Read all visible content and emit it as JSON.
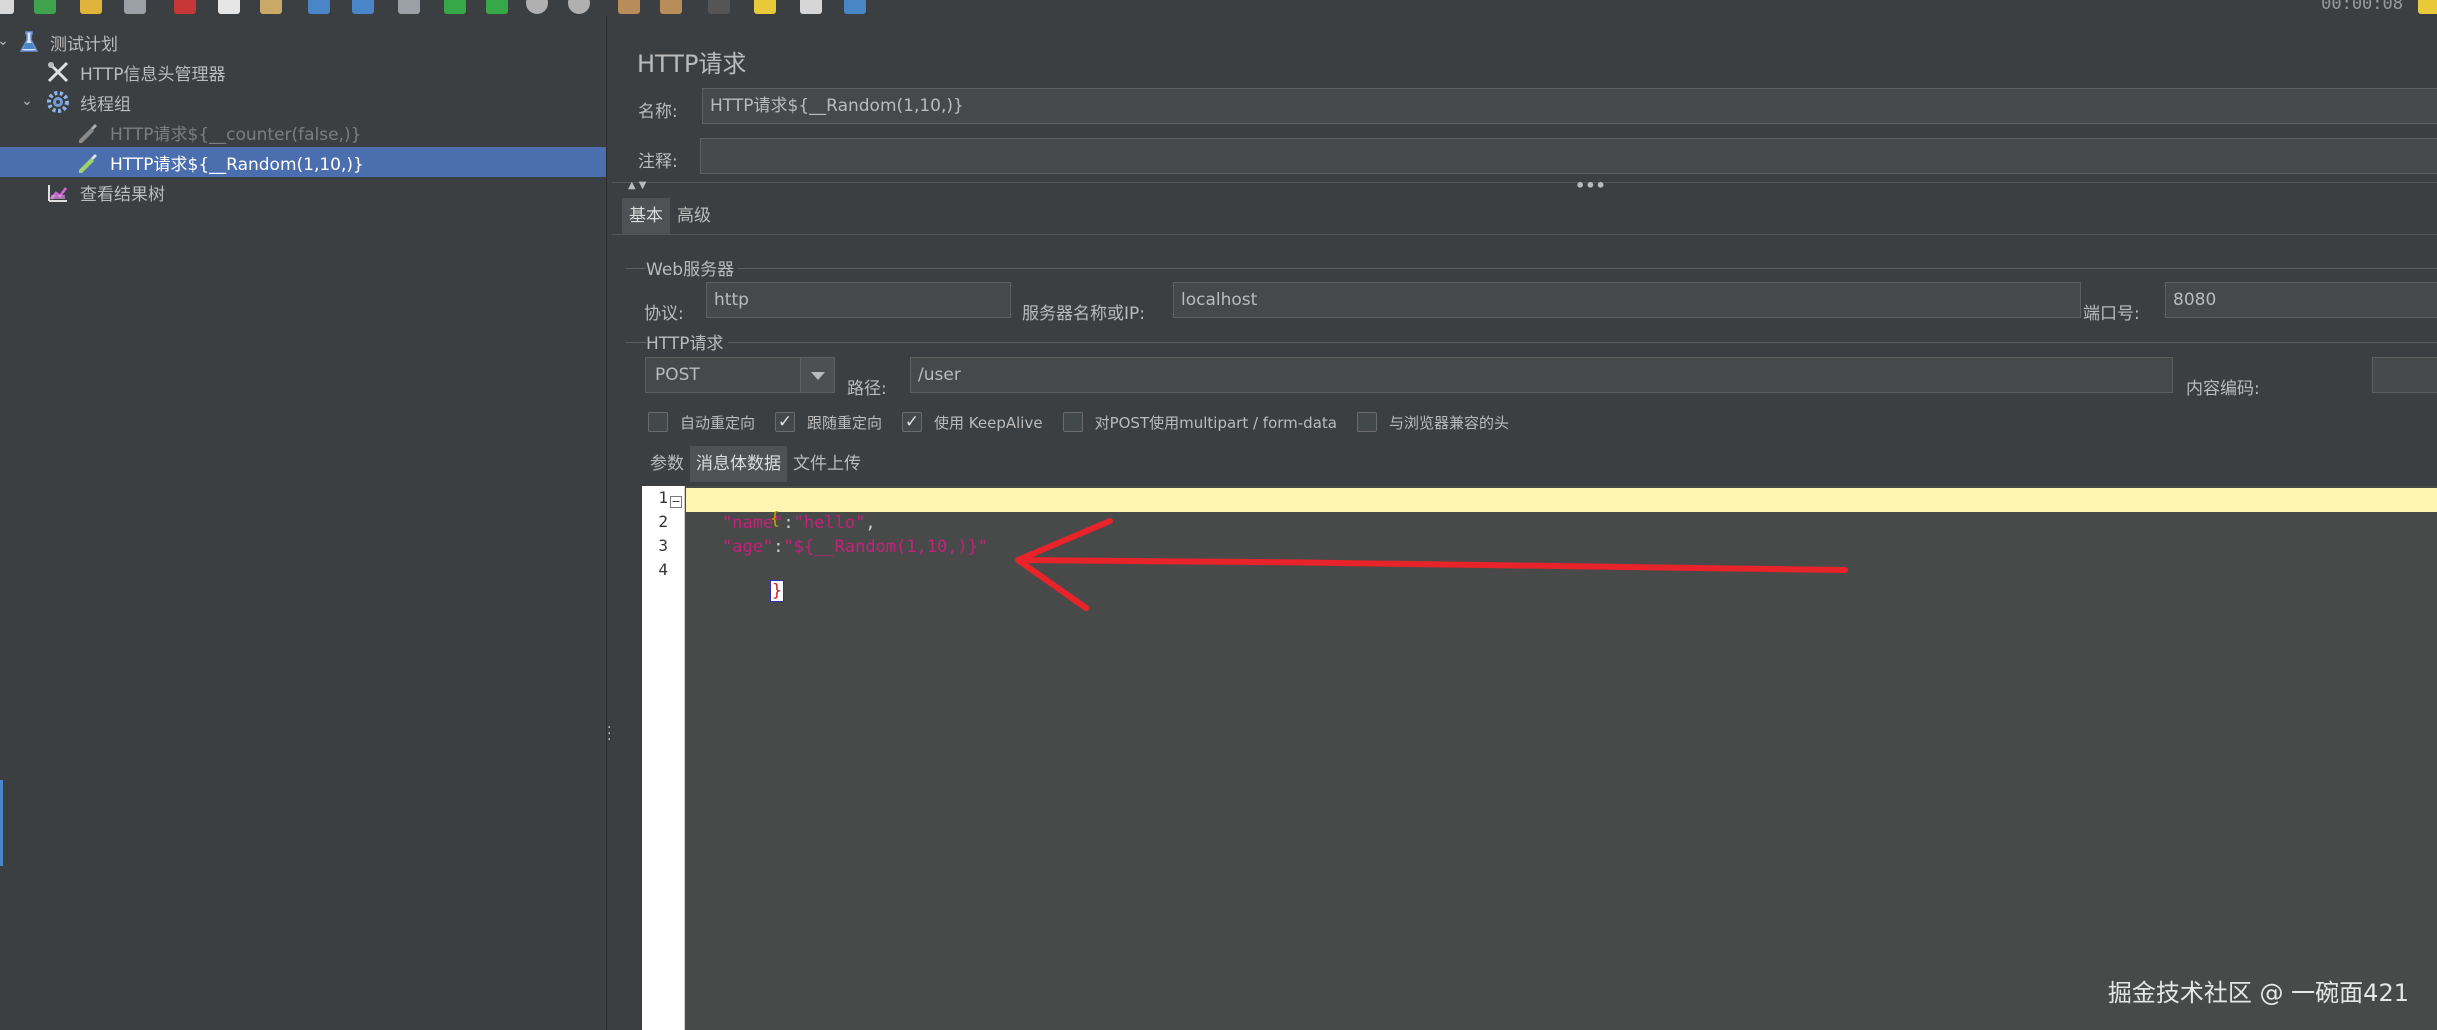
{
  "toolbar": {
    "clock": "00:00:08",
    "buttons": [
      "new-icon",
      "templates-icon",
      "open-icon",
      "save-icon",
      "cut-icon",
      "copy-icon",
      "paste-icon",
      "expand-icon",
      "collapse-icon",
      "toggle-icon",
      "start-icon",
      "start-no-pause-icon",
      "stop-icon",
      "shutdown-icon",
      "clear-icon",
      "clear-all-icon",
      "search-icon",
      "reset-search-icon",
      "function-helper-icon",
      "help-icon"
    ]
  },
  "tree": {
    "items": [
      {
        "label": "测试计划",
        "icon": "flask-icon",
        "state": "expanded"
      },
      {
        "label": "HTTP信息头管理器",
        "icon": "wrench-icon"
      },
      {
        "label": "线程组",
        "icon": "gear-icon",
        "state": "expanded"
      },
      {
        "label": "HTTP请求${__counter(false,)}",
        "icon": "pipette-icon",
        "disabled": true
      },
      {
        "label": "HTTP请求${__Random(1,10,)}",
        "icon": "pipette-icon",
        "selected": true
      },
      {
        "label": "查看结果树",
        "icon": "chart-icon"
      }
    ]
  },
  "detail": {
    "title": "HTTP请求",
    "name_label": "名称:",
    "name_value": "HTTP请求${__Random(1,10,)}",
    "comment_label": "注释:",
    "comment_value": "",
    "tabs": [
      "基本",
      "高级"
    ],
    "web_server": {
      "group_title": "Web服务器",
      "protocol_label": "协议:",
      "protocol_value": "http",
      "server_label": "服务器名称或IP:",
      "server_value": "localhost",
      "port_label": "端口号:",
      "port_value": "8080"
    },
    "http_request": {
      "group_title": "HTTP请求",
      "method": "POST",
      "path_label": "路径:",
      "path_value": "/user",
      "encoding_label": "内容编码:",
      "encoding_value": ""
    },
    "checkboxes": [
      {
        "label": "自动重定向",
        "checked": false
      },
      {
        "label": "跟随重定向",
        "checked": true
      },
      {
        "label": "使用 KeepAlive",
        "checked": true
      },
      {
        "label": "对POST使用multipart / form-data",
        "checked": false
      },
      {
        "label": "与浏览器兼容的头",
        "checked": false
      }
    ],
    "sub_tabs": [
      "参数",
      "消息体数据",
      "文件上传"
    ],
    "editor": {
      "line_numbers": [
        "1",
        "2",
        "3",
        "4"
      ],
      "line1": "{",
      "line2_key": "\"name\"",
      "line2_colon": ":",
      "line2_value": "\"hello\"",
      "line2_comma": ",",
      "line3_key": "\"age\"",
      "line3_colon": ":",
      "line3_value": "\"${__Random(1,10,)}\"",
      "line4": "}"
    }
  },
  "watermark": "掘金技术社区 @ 一碗面421",
  "colors": {
    "panel_bg": "#3c3f41",
    "selection": "#4b6eaf",
    "annotation_arrow": "#e8232a",
    "string": "#c5207a",
    "current_line": "#fff5b1"
  }
}
